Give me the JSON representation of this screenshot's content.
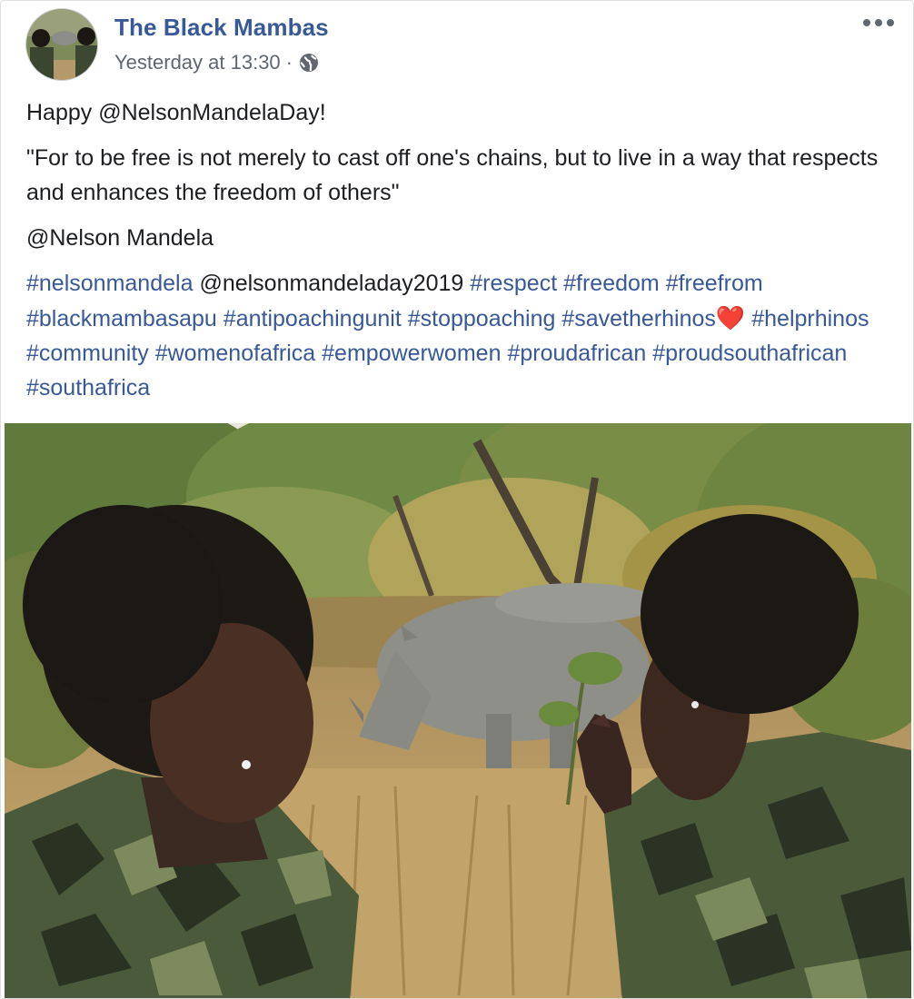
{
  "post": {
    "page_name": "The Black Mambas",
    "timestamp": "Yesterday at 13:30",
    "separator": "·",
    "privacy_icon": "globe-icon",
    "more_icon": "more-options-icon",
    "paragraphs": [
      "Happy @NelsonMandelaDay!",
      "\"For to be free is not merely to cast off one's chains, but to live in a way that respects and enhances the freedom of others\"",
      "@Nelson Mandela"
    ],
    "tags": [
      {
        "text": "#nelsonmandela",
        "type": "hashtag"
      },
      {
        "text": "@nelsonmandeladay2019",
        "type": "plain"
      },
      {
        "text": "#respect",
        "type": "hashtag"
      },
      {
        "text": "#freedom",
        "type": "hashtag"
      },
      {
        "text": "#freefrom",
        "type": "hashtag"
      },
      {
        "text": "#blackmambasapu",
        "type": "hashtag"
      },
      {
        "text": "#antipoachingunit",
        "type": "hashtag"
      },
      {
        "text": "#stoppoaching",
        "type": "hashtag"
      },
      {
        "text": "#savetherhinos",
        "type": "hashtag"
      },
      {
        "text": "#helprhinos",
        "type": "hashtag"
      },
      {
        "text": "#community",
        "type": "hashtag"
      },
      {
        "text": "#womenofafrica",
        "type": "hashtag"
      },
      {
        "text": "#empowerwomen",
        "type": "hashtag"
      },
      {
        "text": "#proudafrican",
        "type": "hashtag"
      },
      {
        "text": "#proudsouthafrican",
        "type": "hashtag"
      },
      {
        "text": "#southafrica",
        "type": "hashtag"
      }
    ],
    "heart_emoji": "❤️",
    "photo_icon": "post-photo"
  },
  "colors": {
    "link": "#385898",
    "meta": "#606770",
    "text": "#1c1e21"
  }
}
